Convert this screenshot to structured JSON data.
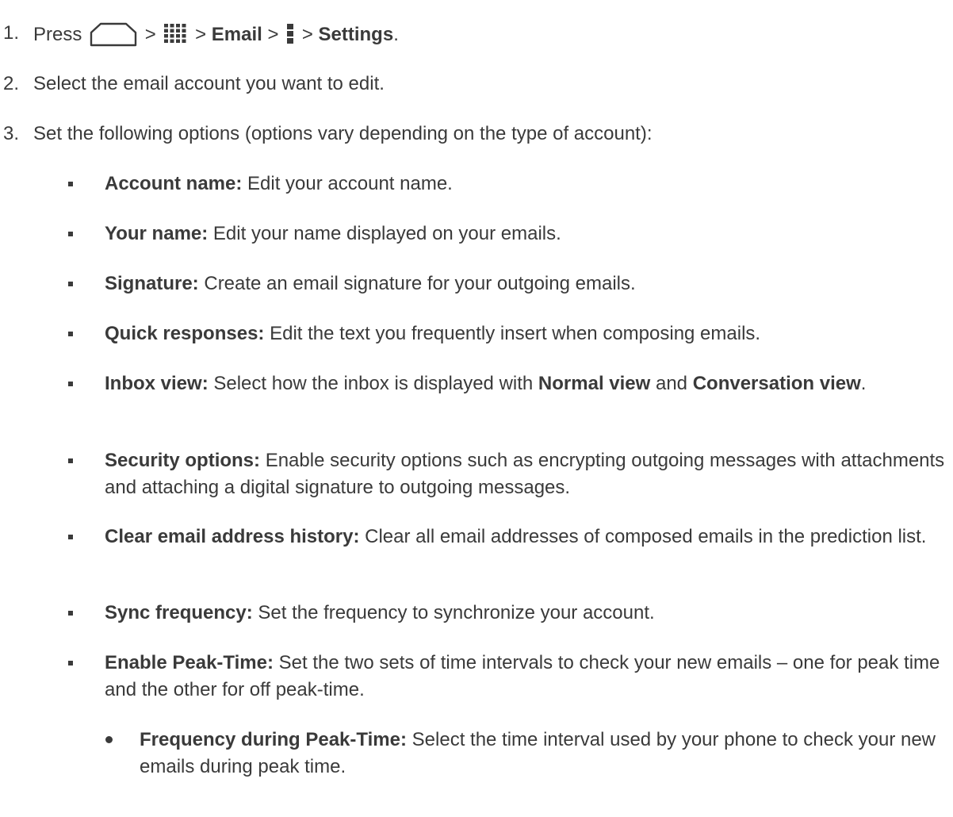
{
  "steps": [
    {
      "number": "1.",
      "parts": {
        "press": "Press",
        "sep1": ">",
        "sep2": ">",
        "email": "Email",
        "sep3": ">",
        "sep4": ">",
        "settings": "Settings",
        "end": "."
      },
      "icons": [
        "home-key-icon",
        "apps-grid-icon",
        "menu-icon"
      ]
    },
    {
      "number": "2.",
      "text": "Select the email account you want to edit."
    },
    {
      "number": "3.",
      "text": "Set the following options (options vary depending on the type of account):"
    }
  ],
  "options": [
    {
      "term": "Account name:",
      "desc": " Edit your account name."
    },
    {
      "term": "Your name:",
      "desc": " Edit your name displayed on your emails."
    },
    {
      "term": "Signature:",
      "desc": " Create an email signature for your outgoing emails."
    },
    {
      "term": "Quick responses:",
      "desc": " Edit the text you frequently insert when composing emails."
    },
    {
      "term": "Inbox view:",
      "desc_a": " Select how the inbox is displayed with ",
      "bold_a": "Normal view",
      "desc_b": " and ",
      "bold_b": "Conversation view",
      "desc_c": "."
    },
    {
      "term": "Security options:",
      "desc": " Enable security options such as encrypting outgoing messages with attachments and attaching a digital signature to outgoing messages."
    },
    {
      "term": "Clear email address history:",
      "desc": " Clear all email addresses of composed emails in the prediction list."
    },
    {
      "term": "Sync frequency:",
      "desc": " Set the frequency to synchronize your account."
    },
    {
      "term": "Enable Peak-Time:",
      "desc": " Set the two sets of time intervals to check your new emails – one for peak time and the other for off peak-time."
    }
  ],
  "sub_options": [
    {
      "term": "Frequency during Peak-Time:",
      "desc": " Select the time interval used by your phone to check your new emails during peak time."
    }
  ],
  "colors": {
    "text": "#3a3a3a",
    "icon": "#3a3a3a"
  }
}
